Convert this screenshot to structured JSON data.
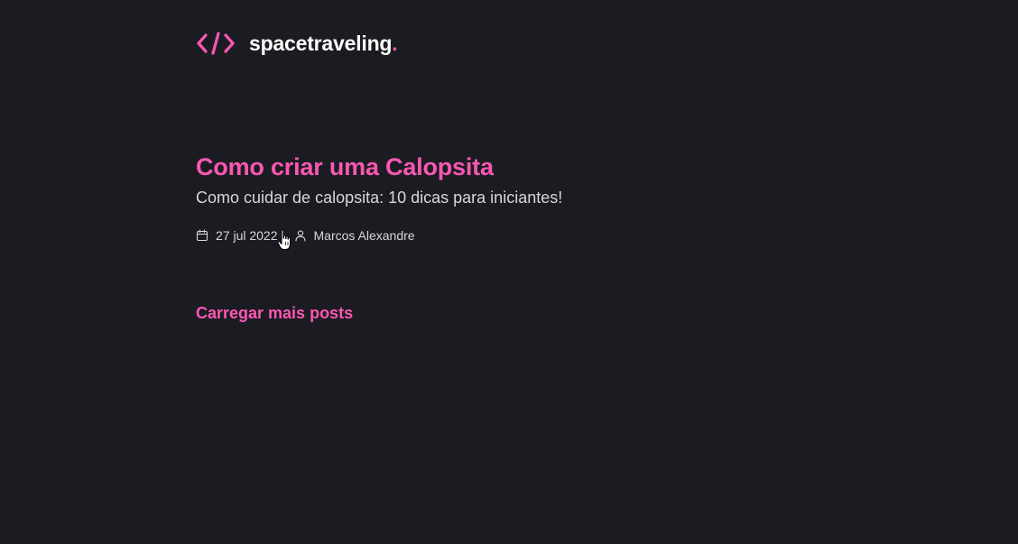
{
  "header": {
    "brand_name": "spacetraveling",
    "brand_dot": ".",
    "logo_icon": "code-brackets-icon",
    "accent_color": "#ff57b2"
  },
  "posts": [
    {
      "title": "Como criar uma Calopsita",
      "subtitle": "Como cuidar de calopsita: 10 dicas para iniciantes!",
      "date": "27 jul 2022",
      "author": "Marcos Alexandre",
      "date_icon": "calendar-icon",
      "author_icon": "user-icon"
    }
  ],
  "load_more_label": "Carregar mais posts",
  "colors": {
    "background": "#1b1c22",
    "text": "#d7d7d7",
    "heading": "#ffffff",
    "accent": "#ff57b2"
  }
}
